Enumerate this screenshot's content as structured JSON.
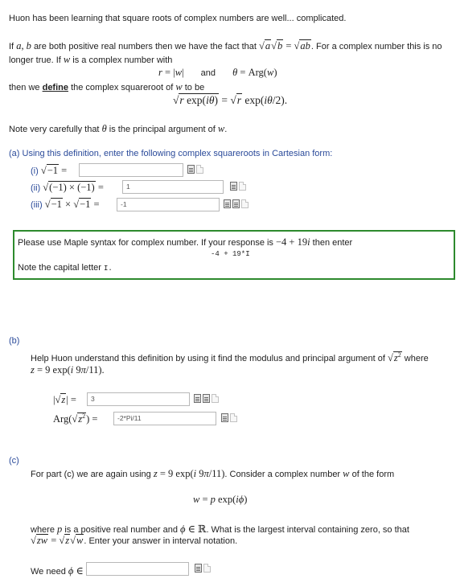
{
  "intro": {
    "p1": "Huon has been learning that square roots of complex numbers are well... complicated.",
    "p2a": "If",
    "p2b": "are both positive real numbers then we have the fact that",
    "p2c": ". For a complex number this is no",
    "p2d": "longer true. If",
    "p2e": "is a complex number with",
    "and": "and",
    "then": "then we",
    "define": "define",
    "then2": "the complex squareroot of",
    "tobe": "to be",
    "note": "Note very carefully that",
    "note2": "is the principal argument of"
  },
  "part_a": {
    "label": "(a) Using this definition, enter the following complex squareroots in Cartesian form:",
    "i_label": "(i)",
    "ii_label": "(ii)",
    "iii_label": "(iii)",
    "i_value": "",
    "ii_value": "1",
    "iii_value": "-1"
  },
  "notebox": {
    "line1a": "Please use Maple syntax for complex number. If your response is",
    "line1b": "then enter",
    "code": "-4 + 19*I",
    "line3": "Note the capital letter",
    "capital": "I."
  },
  "part_b": {
    "label": "(b)",
    "text": "Help Huon understand this definition by using it find the modulus and principal argument of",
    "where": "where",
    "mod_value": "3",
    "arg_value": "-2*Pi/11"
  },
  "part_c": {
    "label": "(c)",
    "text1": "For part (c) we are again using",
    "text1b": ". Consider a complex number",
    "text1c": "of the form",
    "text2a": "where",
    "text2b": "is a positive real number and",
    "text2c": ". What is the largest interval containing zero, so that",
    "text3": ". Enter your answer in interval notation.",
    "weneed": "We need",
    "phi_value": ""
  }
}
